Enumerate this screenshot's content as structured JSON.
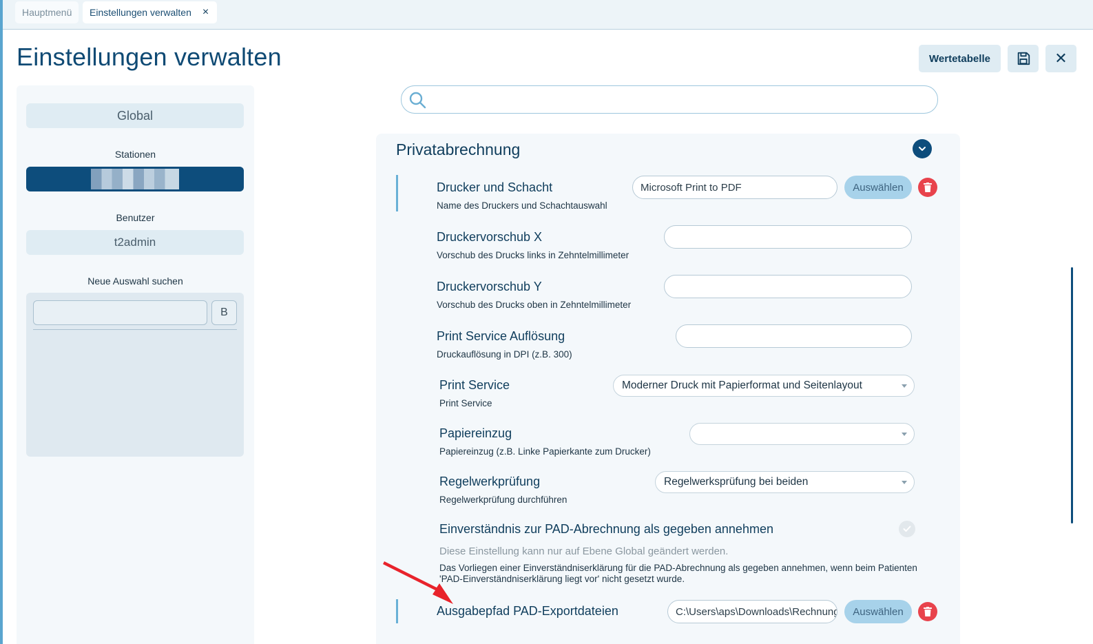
{
  "tabs": [
    {
      "label": "Hauptmenü",
      "active": false
    },
    {
      "label": "Einstellungen verwalten",
      "active": true,
      "close_icon": "×"
    }
  ],
  "page": {
    "title": "Einstellungen verwalten",
    "wertetabelle_label": "Wertetabelle",
    "save_icon": "floppy-disk-icon",
    "close_glyph": "✕"
  },
  "sidebar": {
    "global_label": "Global",
    "stationen_label": "Stationen",
    "station_selected": "",
    "benutzer_label": "Benutzer",
    "benutzer_value": "t2admin",
    "neue_auswahl_label": "Neue Auswahl suchen",
    "search_value": "",
    "search_button_label": "B"
  },
  "search": {
    "value": "",
    "icon": "search-icon"
  },
  "section": {
    "title": "Privatabrechnung",
    "settings": {
      "drucker": {
        "title": "Drucker und Schacht",
        "desc": "Name des Druckers und Schachtauswahl",
        "value": "Microsoft Print to PDF",
        "button": "Auswählen"
      },
      "vorschub_x": {
        "title": "Druckervorschub X",
        "desc": "Vorschub des Drucks links in Zehntelmillimeter",
        "value": ""
      },
      "vorschub_y": {
        "title": "Druckervorschub Y",
        "desc": "Vorschub des Drucks oben in Zehntelmillimeter",
        "value": ""
      },
      "aufloesung": {
        "title": "Print Service Auflösung",
        "desc": "Druckauflösung in DPI (z.B. 300)",
        "value": ""
      },
      "print_service": {
        "title": "Print Service",
        "desc": "Print Service",
        "value": "Moderner Druck mit Papierformat und Seitenlayout"
      },
      "papiereinzug": {
        "title": "Papiereinzug",
        "desc": "Papiereinzug (z.B. Linke Papierkante zum Drucker)",
        "value": ""
      },
      "regelwerk": {
        "title": "Regelwerkprüfung",
        "desc": "Regelwerkprüfung durchführen",
        "value": "Regelwerksprüfung bei beiden"
      },
      "einverstaendnis": {
        "title": "Einverständnis zur PAD-Abrechnung als gegeben annehmen",
        "note": "Diese Einstellung kann nur auf Ebene Global geändert werden.",
        "desc_line1": "Das Vorliegen einer Einverständniserklärung für die PAD-Abrechnung als gegeben annehmen, wenn beim Patienten",
        "desc_line2": "'PAD-Einverständniserklärung liegt vor' nicht gesetzt wurde.",
        "checked": true
      },
      "ausgabepfad": {
        "title": "Ausgabepfad PAD-Exportdateien",
        "value": "C:\\Users\\aps\\Downloads\\Rechnungen",
        "button": "Auswählen"
      }
    }
  },
  "colors": {
    "primary": "#0d4d7c",
    "accent": "#a7d2ea",
    "danger": "#e8434c",
    "annotation_arrow": "#e8232b"
  }
}
